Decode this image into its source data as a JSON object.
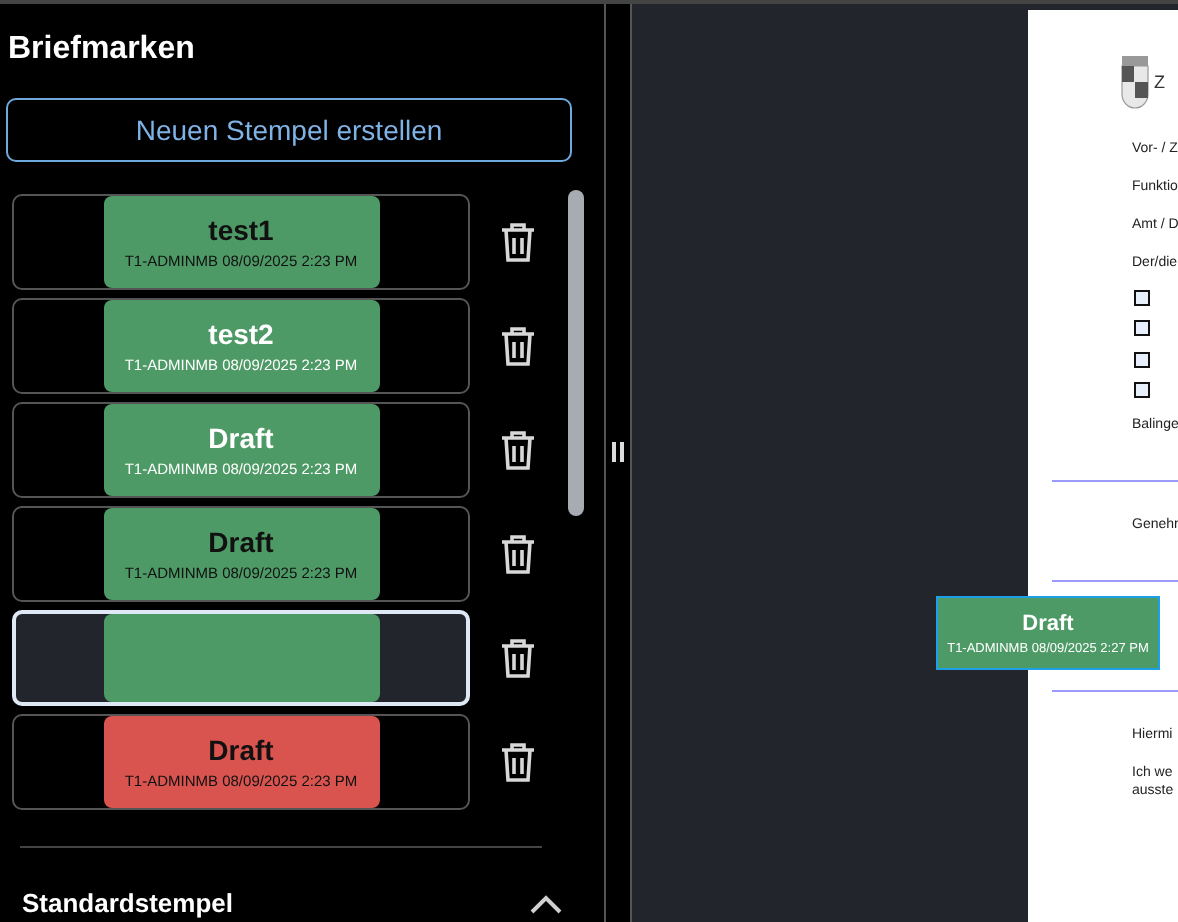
{
  "panel": {
    "title": "Briefmarken",
    "create_button": "Neuen Stempel erstellen"
  },
  "stamps": [
    {
      "title": "test1",
      "meta": "T1-ADMINMB 08/09/2025 2:23 PM",
      "color": "#4e9a66",
      "dark_text": true,
      "selected": false
    },
    {
      "title": "test2",
      "meta": "T1-ADMINMB 08/09/2025 2:23 PM",
      "color": "#4e9a66",
      "dark_text": false,
      "selected": false
    },
    {
      "title": "Draft",
      "meta": "T1-ADMINMB 08/09/2025 2:23 PM",
      "color": "#4e9a66",
      "dark_text": false,
      "selected": false
    },
    {
      "title": "Draft",
      "meta": "T1-ADMINMB 08/09/2025 2:23 PM",
      "color": "#4e9a66",
      "dark_text": true,
      "selected": false
    },
    {
      "color": "#4e9a66",
      "selected": true
    },
    {
      "title": "Draft",
      "meta": "T1-ADMINMB 08/09/2025 2:23 PM",
      "color": "#d9534f",
      "dark_text": true,
      "selected": false
    }
  ],
  "section": {
    "title": "Standardstempel",
    "expanded": true
  },
  "document": {
    "header": "Z",
    "lines": [
      {
        "kind": "text",
        "text": "Vor- / Z"
      },
      {
        "kind": "text",
        "text": "Funktio"
      },
      {
        "kind": "text",
        "text": "Amt / D"
      },
      {
        "kind": "text",
        "text": "Der/die"
      },
      {
        "kind": "checkbox",
        "checked": false
      },
      {
        "kind": "checkbox",
        "checked": false
      },
      {
        "kind": "checkbox",
        "checked": false
      },
      {
        "kind": "checkbox",
        "checked": false
      },
      {
        "kind": "text",
        "text": "Balinge"
      },
      {
        "kind": "rule"
      },
      {
        "kind": "text",
        "text": "Genehr"
      },
      {
        "kind": "rule"
      },
      {
        "kind": "rule"
      },
      {
        "kind": "text",
        "text": "Hiermi"
      },
      {
        "kind": "text",
        "text": "Ich we\nausste"
      }
    ],
    "placed_stamp": {
      "title": "Draft",
      "meta": "T1-ADMINMB 08/09/2025 2:27 PM",
      "color": "#4e9a66",
      "dark_text": false,
      "selected": true
    }
  }
}
